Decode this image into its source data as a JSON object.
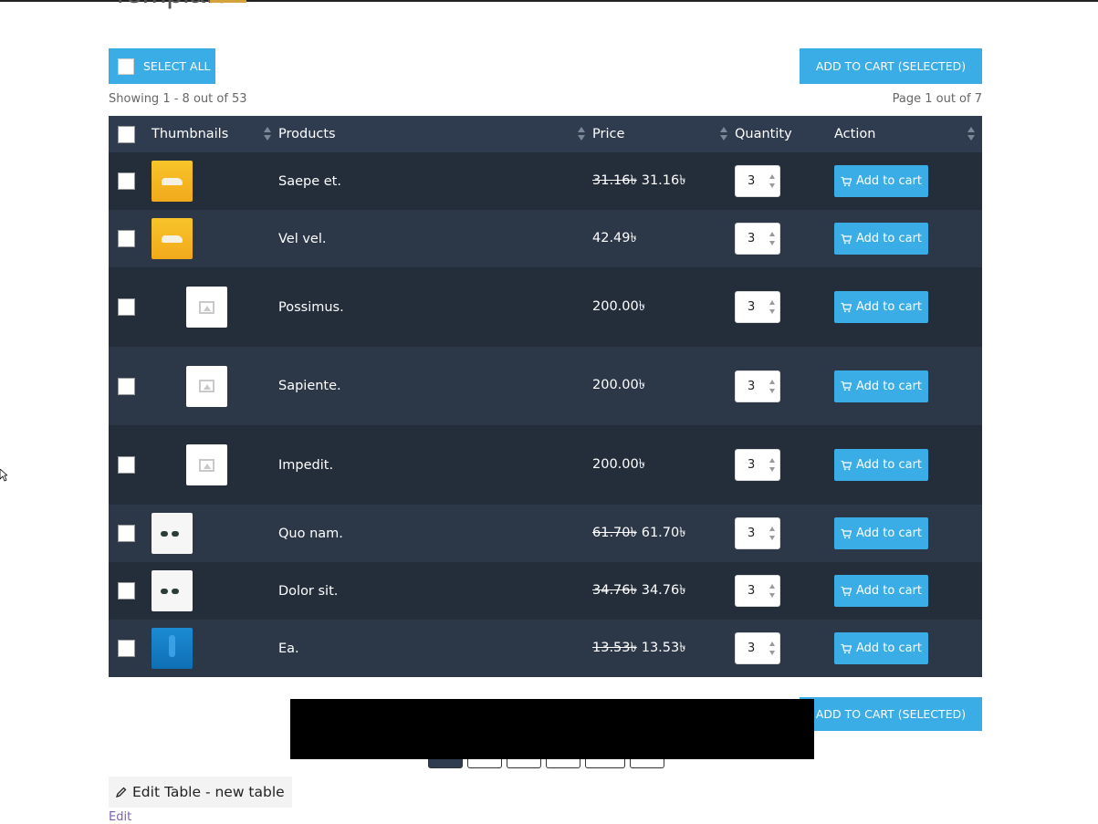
{
  "page": {
    "heading_partial": "Template",
    "select_all_label": "SELECT ALL",
    "add_selected_label": "ADD TO CART (SELECTED)",
    "showing_text": "Showing 1 - 8 out of 53",
    "page_text": "Page 1 out of 7",
    "edit_table_label": "Edit Table - new table",
    "edit_link": "Edit"
  },
  "table": {
    "headers": {
      "thumbnails": "Thumbnails",
      "products": "Products",
      "price": "Price",
      "quantity": "Quantity",
      "action": "Action"
    },
    "rows": [
      {
        "thumb": "yellow-car-image",
        "name": "Saepe et.",
        "old_price": "31.16৳",
        "price": "31.16৳",
        "qty": "3",
        "action": "Add to cart"
      },
      {
        "thumb": "yellow-car-image",
        "name": "Vel vel.",
        "old_price": "",
        "price": "42.49৳",
        "qty": "3",
        "action": "Add to cart"
      },
      {
        "thumb": "placeholder-image",
        "name": "Possimus.",
        "old_price": "",
        "price": "200.00৳",
        "qty": "3",
        "action": "Add to cart"
      },
      {
        "thumb": "placeholder-image",
        "name": "Sapiente.",
        "old_price": "",
        "price": "200.00৳",
        "qty": "3",
        "action": "Add to cart"
      },
      {
        "thumb": "placeholder-image",
        "name": "Impedit.",
        "old_price": "",
        "price": "200.00৳",
        "qty": "3",
        "action": "Add to cart"
      },
      {
        "thumb": "sunglasses-image",
        "name": "Quo nam.",
        "old_price": "61.70৳",
        "price": "61.70৳",
        "qty": "3",
        "action": "Add to cart"
      },
      {
        "thumb": "sunglasses-image",
        "name": "Dolor sit.",
        "old_price": "34.76৳",
        "price": "34.76৳",
        "qty": "3",
        "action": "Add to cart"
      },
      {
        "thumb": "blue-bottle-image",
        "name": "Ea.",
        "old_price": "13.53৳",
        "price": "13.53৳",
        "qty": "3",
        "action": "Add to cart"
      }
    ]
  },
  "colors": {
    "accent": "#3aace6",
    "header_bg": "#2f3b4e",
    "row_dark": "#242e3b",
    "row_light": "#2c3748"
  }
}
